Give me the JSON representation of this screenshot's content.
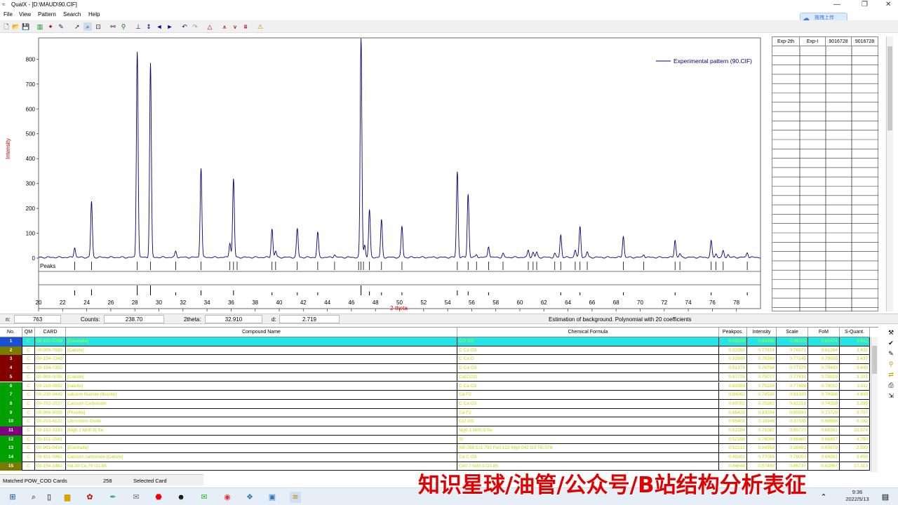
{
  "window": {
    "title": "QualX - [D:\\MAUD\\90.CIF]"
  },
  "menu": [
    "File",
    "View",
    "Pattern",
    "Search",
    "Help"
  ],
  "upload_button": "拖拽上传",
  "plot": {
    "legend": "Experimental pattern (90.CIF)",
    "ylabel": "Intensity",
    "xlabel": "2-theta",
    "peaks_label": "Peaks",
    "line_color": "#00007f",
    "yticks": [
      "0",
      "100",
      "200",
      "300",
      "400",
      "500",
      "600",
      "700",
      "800"
    ],
    "xticks": [
      "20",
      "22",
      "24",
      "26",
      "28",
      "30",
      "32",
      "34",
      "36",
      "38",
      "40",
      "42",
      "44",
      "46",
      "48",
      "50",
      "52",
      "54",
      "56",
      "58",
      "60",
      "62",
      "64",
      "66",
      "68",
      "70",
      "72",
      "74",
      "76",
      "78"
    ]
  },
  "chart_data": {
    "type": "line",
    "xlabel": "2-theta",
    "ylabel": "Intensity",
    "xlim": [
      20,
      80
    ],
    "ylim": [
      0,
      880
    ],
    "series": [
      {
        "name": "Experimental pattern (90.CIF)"
      }
    ],
    "peaks": [
      [
        23.0,
        40
      ],
      [
        24.4,
        225
      ],
      [
        28.2,
        830
      ],
      [
        29.3,
        780
      ],
      [
        31.4,
        25
      ],
      [
        33.5,
        360
      ],
      [
        35.9,
        60
      ],
      [
        36.2,
        315
      ],
      [
        39.4,
        115
      ],
      [
        39.7,
        25
      ],
      [
        41.5,
        115
      ],
      [
        43.2,
        100
      ],
      [
        44.6,
        12
      ],
      [
        46.8,
        880
      ],
      [
        47.1,
        50
      ],
      [
        47.5,
        190
      ],
      [
        48.5,
        150
      ],
      [
        50.2,
        125
      ],
      [
        54.8,
        345
      ],
      [
        55.7,
        255
      ],
      [
        56.4,
        12
      ],
      [
        57.4,
        45
      ],
      [
        58.6,
        15
      ],
      [
        60.7,
        30
      ],
      [
        61.1,
        20
      ],
      [
        61.4,
        20
      ],
      [
        62.9,
        15
      ],
      [
        63.4,
        90
      ],
      [
        64.6,
        30
      ],
      [
        65.0,
        125
      ],
      [
        65.6,
        22
      ],
      [
        68.6,
        85
      ],
      [
        70.3,
        12
      ],
      [
        72.9,
        70
      ],
      [
        73.3,
        15
      ],
      [
        75.9,
        65
      ],
      [
        76.3,
        15
      ],
      [
        76.9,
        25
      ],
      [
        77.3,
        12
      ],
      [
        78.9,
        20
      ]
    ],
    "peak_markers": [
      23.0,
      24.4,
      28.2,
      29.3,
      31.4,
      33.5,
      35.9,
      36.2,
      36.5,
      39.4,
      39.7,
      41.5,
      43.2,
      44.6,
      46.6,
      46.8,
      47.0,
      47.5,
      48.5,
      50.2,
      54.8,
      55.7,
      56.4,
      57.4,
      58.6,
      60.7,
      61.1,
      61.4,
      62.9,
      63.4,
      64.6,
      65.0,
      65.6,
      68.6,
      70.3,
      72.9,
      73.3,
      75.9,
      76.3,
      76.9,
      78.9
    ],
    "ref_sticks": [
      [
        23.0,
        0.5
      ],
      [
        24.4,
        0.6
      ],
      [
        28.2,
        1.0
      ],
      [
        29.3,
        1.0
      ],
      [
        31.4,
        0.3
      ],
      [
        33.5,
        0.5
      ],
      [
        36.2,
        0.5
      ],
      [
        39.4,
        0.3
      ],
      [
        41.5,
        0.3
      ],
      [
        43.2,
        0.3
      ],
      [
        46.8,
        1.0
      ],
      [
        47.5,
        0.4
      ],
      [
        48.5,
        0.3
      ],
      [
        50.2,
        0.3
      ],
      [
        54.8,
        0.5
      ],
      [
        55.7,
        0.4
      ],
      [
        57.4,
        0.3
      ],
      [
        63.4,
        0.3
      ],
      [
        65.0,
        0.3
      ],
      [
        68.6,
        0.3
      ],
      [
        72.9,
        0.3
      ],
      [
        75.9,
        0.3
      ],
      [
        78.9,
        0.3
      ]
    ]
  },
  "ref_table": {
    "headers": [
      "Exp-2th",
      "Exp-I",
      "9016728",
      "9016728"
    ]
  },
  "infobar": {
    "n_label": "n:",
    "n": "763",
    "counts_label": "Counts:",
    "counts": "238.70",
    "theta_label": "2theta:",
    "theta": "32.910",
    "d_label": "d:",
    "d": "2.719",
    "message": "Estimation of background. Polynomial with 20  coefficients"
  },
  "results": {
    "headers": [
      "No.",
      "QM",
      "CARD",
      "Compound Name",
      "Chemical Formula",
      "Peakpos.",
      "Intensity",
      "Scale",
      "FoM",
      "S-Quant."
    ],
    "rows": [
      {
        "no": "1",
        "qm": "C",
        "card": "00-101-5789",
        "name": "[Eskolaite]",
        "formula": "Cr2 O3",
        "peakpos": "0.93329",
        "intensity": "0.84295",
        "scale": "0.39115",
        "fom": "0.81474",
        "squant": "3.611",
        "color": "#1a4fd6",
        "selected": true
      },
      {
        "no": "2",
        "qm": "C",
        "card": "00-900-7689",
        "name": "[Calcite]",
        "formula": "C Ca O3",
        "peakpos": "0.92950",
        "intensity": "0.77814",
        "scale": "0.76971",
        "fom": "0.81264",
        "squant": "3.432",
        "color": "#7a7a00"
      },
      {
        "no": "3",
        "qm": "C",
        "card": "00-154-7348",
        "name": "",
        "formula": "C Ca O",
        "peakpos": "0.92699",
        "intensity": "0.78260",
        "scale": "0.77145",
        "fom": "0.79555",
        "squant": "3.437",
        "color": "#800000"
      },
      {
        "no": "4",
        "qm": "C",
        "card": "00-154-7350",
        "name": "",
        "formula": "C Ca O3",
        "peakpos": "0.91374",
        "intensity": "0.78754",
        "scale": "0.77379",
        "fom": "0.79403",
        "squant": "3.449",
        "color": "#800000"
      },
      {
        "no": "5",
        "qm": "C",
        "card": "00-900-0095",
        "name": "[Calcite]",
        "formula": "Ca(CO3)",
        "peakpos": "0.87725",
        "intensity": "0.75077",
        "scale": "0.77431",
        "fom": "0.78819",
        "squant": "3.301",
        "color": "#800000"
      },
      {
        "no": "6",
        "qm": "C",
        "card": "00-210-0992",
        "name": "[calcite]",
        "formula": "C Ca O3",
        "peakpos": "0.83389",
        "intensity": "0.75254",
        "scale": "0.77488",
        "fom": "0.78002",
        "squant": "3.311",
        "color": "#00a000"
      },
      {
        "no": "7",
        "qm": "C",
        "card": "00-230-0449",
        "name": "calcium fluoride [fluorite]",
        "formula": "Ca F2",
        "peakpos": "0.84362",
        "intensity": "0.74535",
        "scale": "0.91303",
        "fom": "0.74986",
        "squant": "4.409",
        "color": "#00a000"
      },
      {
        "no": "8",
        "qm": "C",
        "card": "00-702-2027",
        "name": "Calcium Carbonate",
        "formula": "C Ca O3",
        "peakpos": "0.60782",
        "intensity": "0.75262",
        "scale": "0.82218",
        "fom": "0.74258",
        "squant": "3.295",
        "color": "#00a000"
      },
      {
        "no": "9",
        "qm": "C",
        "card": "00-900-9005",
        "name": "[Fluorite]",
        "formula": "Ca F2",
        "peakpos": "0.85425",
        "intensity": "0.83204",
        "scale": "0.85893",
        "fom": "0.73729",
        "squant": "3.707",
        "color": "#00a000"
      },
      {
        "no": "10",
        "qm": "C",
        "card": "00-210-4122",
        "name": "Chromium Oxide",
        "formula": "Cr2 O3",
        "peakpos": "0.95409",
        "intensity": "0.11946",
        "scale": "0.37336",
        "fom": "0.68588",
        "squant": "0.192",
        "color": "#00a000"
      },
      {
        "no": "11",
        "qm": "C",
        "card": "00-152-3393",
        "name": "[Mg0.1 Mn0.9] Se",
        "formula": "Mg0.1 Mn0.9 Se",
        "peakpos": "0.82184",
        "intensity": "0.71087",
        "scale": "0.95770",
        "fom": "0.68361",
        "squant": "10.974",
        "color": "#800080"
      },
      {
        "no": "12",
        "qm": "C",
        "card": "00-151-2541",
        "name": "",
        "formula": "Si",
        "peakpos": "0.52198",
        "intensity": "0.76004",
        "scale": "0.96460",
        "fom": "0.66407",
        "squant": "4.750",
        "color": "#00a000"
      },
      {
        "no": "13",
        "qm": "C",
        "card": "00-901-0434",
        "name": "[Eskolaite]",
        "formula": "Al0.058 Cr1.792 Fe0.122 Mg0.042 O3 Ti0.076",
        "peakpos": "0.52212",
        "intensity": "0.84959",
        "scale": "0.36481",
        "fom": "0.65679",
        "squant": "2.599",
        "color": "#00a000"
      },
      {
        "no": "14",
        "qm": "C",
        "card": "00-101-0962",
        "name": "Calcium carbonate [Calcite]",
        "formula": "Ca C O3",
        "peakpos": "0.40101",
        "intensity": "0.77055",
        "scale": "0.78003",
        "fom": "0.64391",
        "squant": "3.456",
        "color": "#00a000"
      },
      {
        "no": "15",
        "qm": "C",
        "card": "00-154-1462",
        "name": "Nd.30 Ce.70 O1.85",
        "formula": "Ce0.7 Nd0.3 O1.85",
        "peakpos": "0.84644",
        "intensity": "0.57480",
        "scale": "0.86737",
        "fom": "0.63867",
        "squant": "17.313",
        "color": "#7a7a00"
      }
    ]
  },
  "status": {
    "label": "Matched POW_COD Cards",
    "count": "258",
    "selected": "Selected Card"
  },
  "watermark": "知识星球/油管/公众号/B站结构分析表征",
  "clock": {
    "time": "9:36",
    "date": "2022/5/13"
  }
}
